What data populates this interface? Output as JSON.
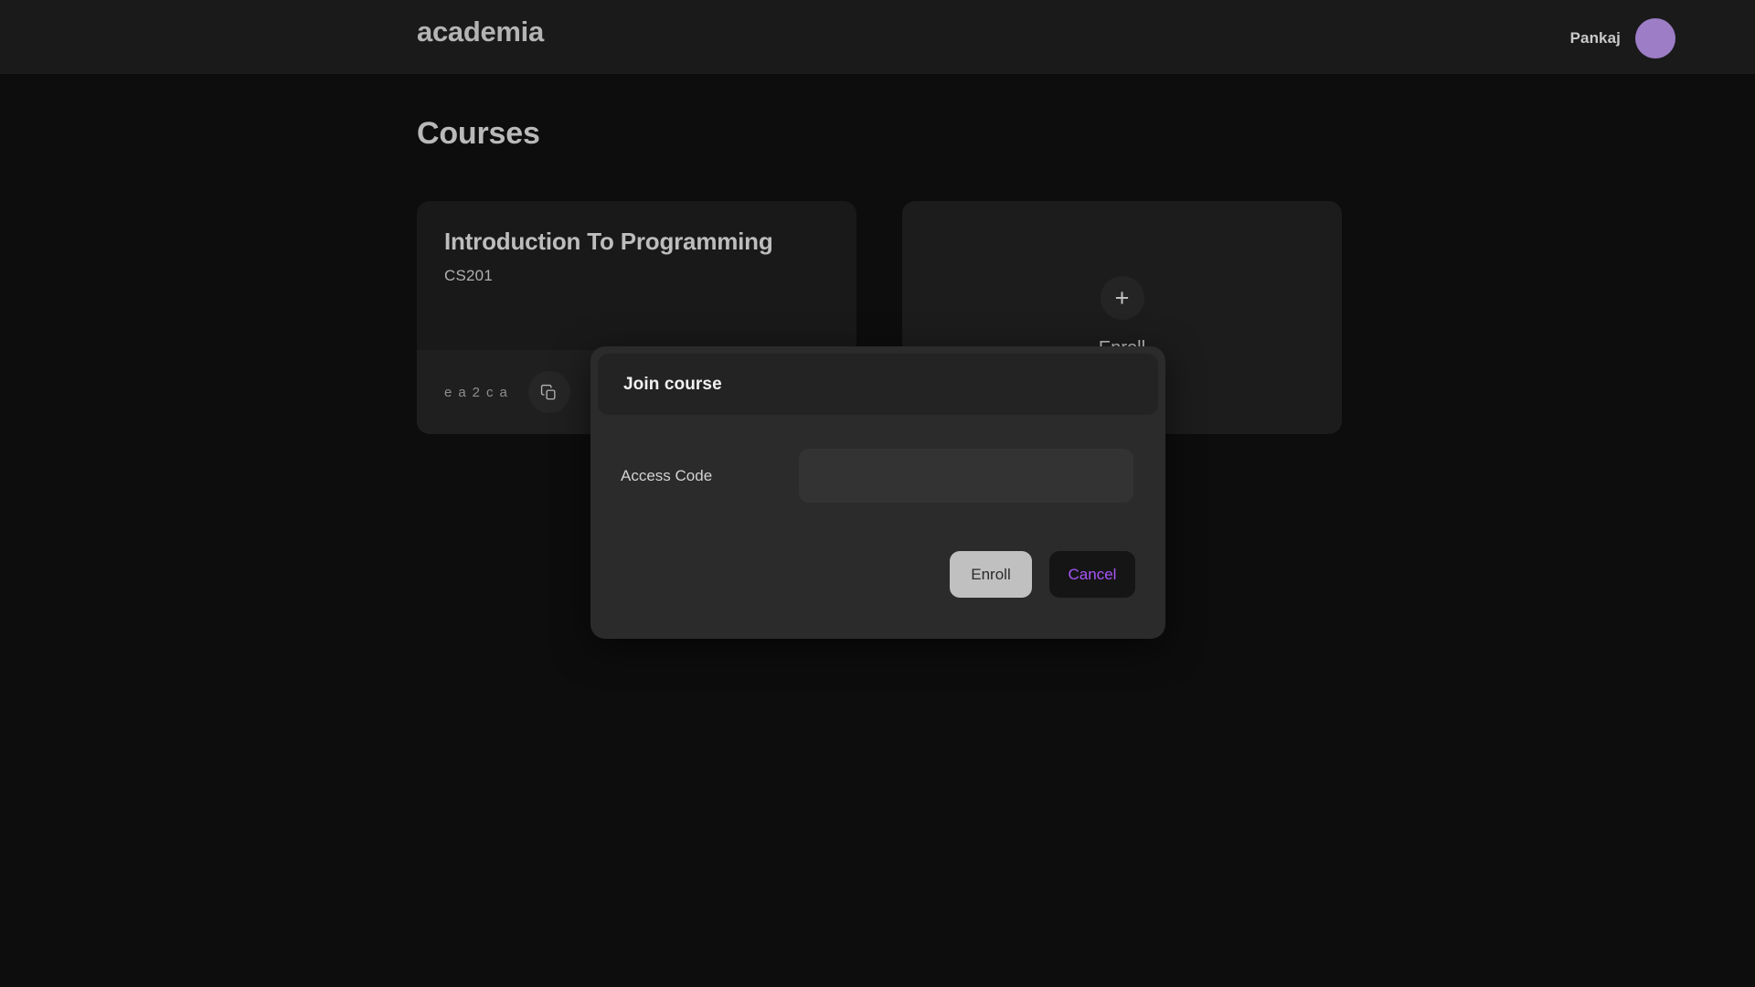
{
  "header": {
    "brand": "academia",
    "user_name": "Pankaj",
    "avatar_color": "#9d7dc6"
  },
  "page": {
    "title": "Courses"
  },
  "courses": [
    {
      "title": "Introduction To Programming",
      "code": "CS201",
      "access_code": "ea2ca",
      "copy_icon": "copy-icon"
    }
  ],
  "enroll_card": {
    "plus_icon": "+",
    "label": "Enroll"
  },
  "modal": {
    "title": "Join course",
    "field_label": "Access Code",
    "field_value": "",
    "field_placeholder": "",
    "primary_button": "Enroll",
    "secondary_button": "Cancel",
    "secondary_button_color": "#a855f7"
  }
}
